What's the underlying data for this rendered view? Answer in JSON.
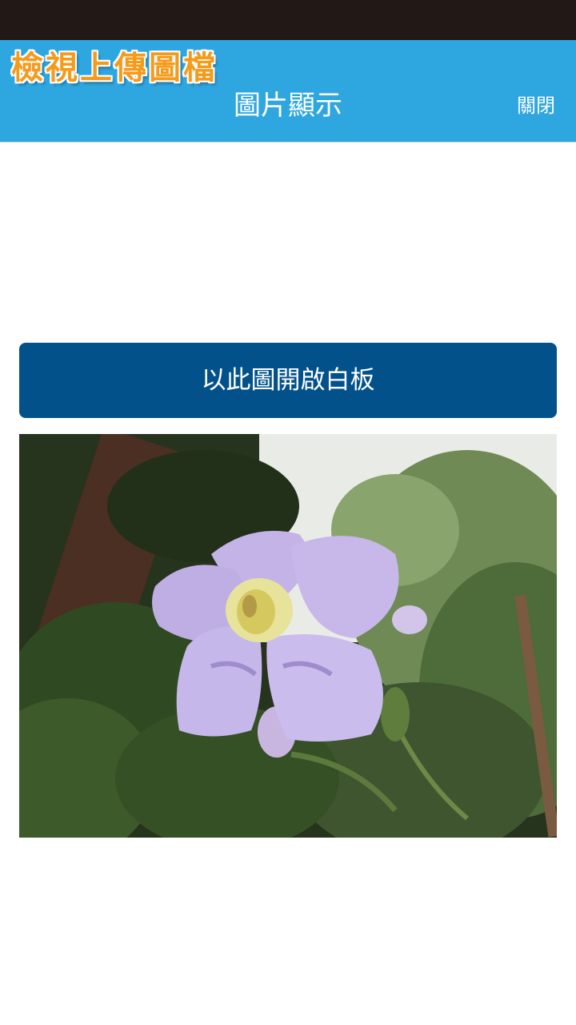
{
  "header": {
    "brand_text": "檢視上傳圖檔",
    "title": "圖片顯示",
    "close_label": "關閉"
  },
  "main": {
    "whiteboard_button_label": "以此圖開啟白板"
  },
  "colors": {
    "status_bar": "#221816",
    "header_bg": "#2ea6e0",
    "brand_text": "#f59b1c",
    "button_bg": "#03518a"
  }
}
